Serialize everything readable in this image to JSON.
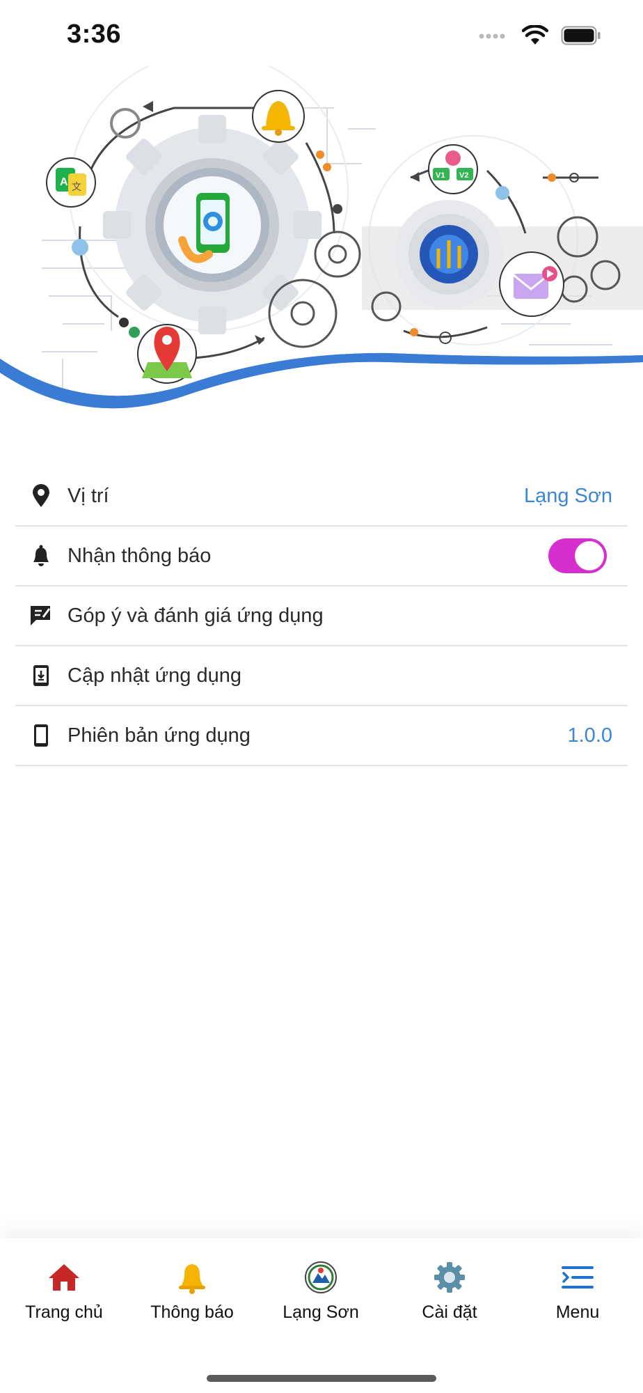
{
  "status_bar": {
    "time": "3:36"
  },
  "settings": {
    "location": {
      "label": "Vị trí",
      "value": "Lạng Sơn"
    },
    "notifications": {
      "label": "Nhận thông báo",
      "enabled": true
    },
    "feedback": {
      "label": "Góp ý và đánh giá ứng dụng"
    },
    "update": {
      "label": "Cập nhật ứng dụng"
    },
    "version": {
      "label": "Phiên bản ứng dụng",
      "value": "1.0.0"
    }
  },
  "tabs": [
    {
      "label": "Trang chủ",
      "icon": "home-icon",
      "color": "#c62828"
    },
    {
      "label": "Thông báo",
      "icon": "bell-icon",
      "color": "#f5b400"
    },
    {
      "label": "Lạng Sơn",
      "icon": "province-emblem-icon",
      "color": "#2e7d32"
    },
    {
      "label": "Cài đặt",
      "icon": "gear-icon",
      "color": "#5b8fa8"
    },
    {
      "label": "Menu",
      "icon": "menu-icon",
      "color": "#1e73d2"
    }
  ],
  "colors": {
    "accent": "#3b86d8",
    "toggle_on": "#d62ecf",
    "wave": "#3a7bd5"
  },
  "hero": {
    "version_badges": [
      "V1",
      "V2"
    ],
    "translate_glyphs": [
      "A",
      "文"
    ]
  }
}
